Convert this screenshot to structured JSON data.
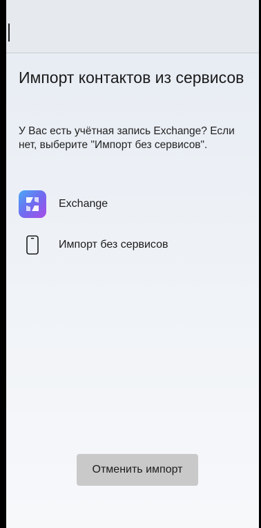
{
  "title": "Импорт контактов из сервисов",
  "description": "У Вас есть учётная запись Exchange? Если нет, выберите \"Импорт без сервисов\".",
  "options": [
    {
      "label": "Exchange",
      "icon": "exchange-app-icon"
    },
    {
      "label": "Импорт без сервисов",
      "icon": "phone-icon"
    }
  ],
  "cancel_label": "Отменить импорт",
  "colors": {
    "background": "#edf1f6",
    "button": "#c9c9c9",
    "exchange_gradient_start": "#4aa8f5",
    "exchange_gradient_end": "#a94ce8"
  }
}
